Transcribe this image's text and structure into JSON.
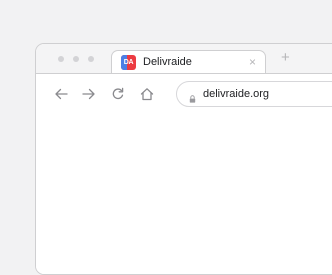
{
  "browser": {
    "tab": {
      "title": "Delivraide",
      "favicon_text": "DA",
      "close_glyph": "×"
    },
    "new_tab_glyph": "+",
    "toolbar": {
      "icons": [
        "back-arrow-icon",
        "forward-arrow-icon",
        "reload-icon",
        "home-icon"
      ]
    },
    "address_bar": {
      "url": "delivraide.org",
      "security_icon": "lock-icon"
    }
  },
  "colors": {
    "favicon_red": "#ec3b42",
    "favicon_blue": "#4d7fe6",
    "chrome_gray": "#f4f4f5",
    "border": "#cfcfd1"
  }
}
